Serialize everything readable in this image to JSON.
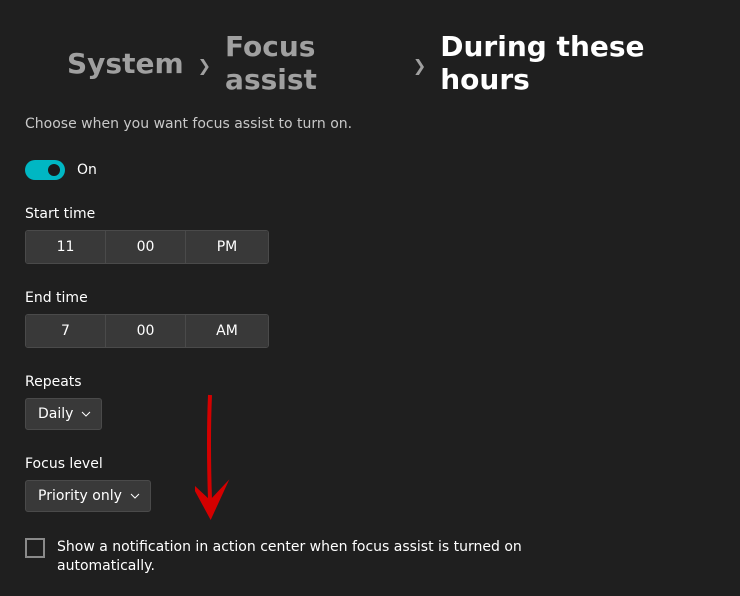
{
  "breadcrumb": {
    "item1": "System",
    "item2": "Focus assist",
    "item3": "During these hours"
  },
  "description": "Choose when you want focus assist to turn on.",
  "toggle": {
    "state_label": "On"
  },
  "start_time": {
    "label": "Start time",
    "hour": "11",
    "minute": "00",
    "period": "PM"
  },
  "end_time": {
    "label": "End time",
    "hour": "7",
    "minute": "00",
    "period": "AM"
  },
  "repeats": {
    "label": "Repeats",
    "value": "Daily"
  },
  "focus_level": {
    "label": "Focus level",
    "value": "Priority only"
  },
  "checkbox": {
    "label": "Show a notification in action center when focus assist is turned on automatically."
  }
}
